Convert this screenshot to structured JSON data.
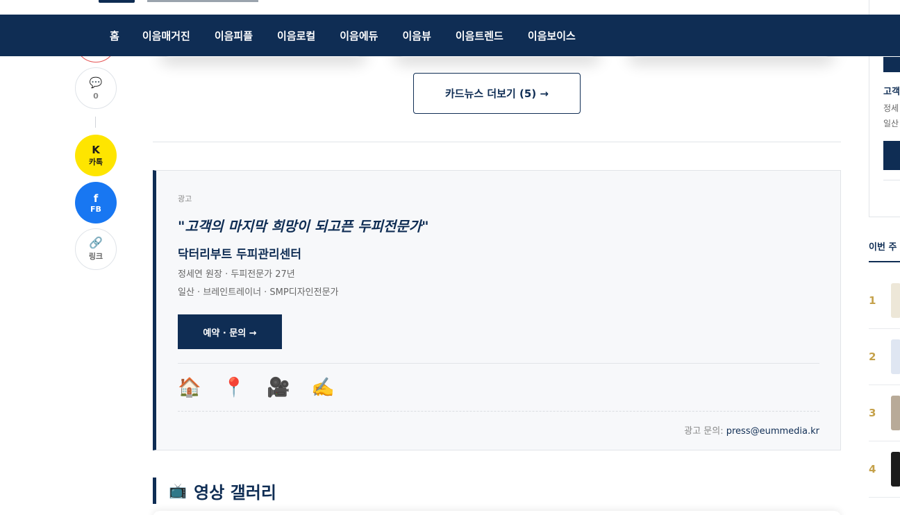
{
  "nav": {
    "items": [
      "홈",
      "이음매거진",
      "이음피플",
      "이음로컬",
      "이음에듀",
      "이음뷰",
      "이음트렌드",
      "이음보이스"
    ]
  },
  "share": {
    "comment_icon": "comment-icon",
    "comment_count": "0",
    "kakao_glyph": "K",
    "kakao_label": "카톡",
    "facebook_glyph": "f",
    "facebook_label": "FB",
    "link_icon": "link-icon",
    "link_label": "링크"
  },
  "more_cardnews": {
    "label": "카드뉴스 더보기 (5) →"
  },
  "ad": {
    "label": "광고",
    "quote": "\"고객의 마지막 희망이 되고픈 두피전문가\"",
    "name": "닥터리부트 두피관리센터",
    "line1": "정세연 원장 · 두피전문가 27년",
    "line2": "일산 · 브레인트레이너 · SMP디자인전문가",
    "cta": "예약 · 문의 →",
    "icons": [
      "home-icon",
      "location-pin-icon",
      "video-camera-icon",
      "writing-icon"
    ],
    "icon_glyphs": [
      "🏠",
      "📍",
      "🎥",
      "✍️"
    ],
    "contact_label": "광고 문의:",
    "contact_email": "press@eummedia.kr"
  },
  "video_gallery": {
    "icon": "tv-icon",
    "title": "영상 갤러리"
  },
  "sidebar": {
    "ad_title_cut": "고객",
    "ad_line1_cut": "정세",
    "ad_line2_cut": "일산",
    "weekly_title_cut": "이번 주",
    "ranks": [
      "1",
      "2",
      "3",
      "4"
    ]
  },
  "colors": {
    "navy": "#0f2d54",
    "gold": "#c5a14a",
    "kakao": "#fee500",
    "facebook": "#1877f2"
  }
}
